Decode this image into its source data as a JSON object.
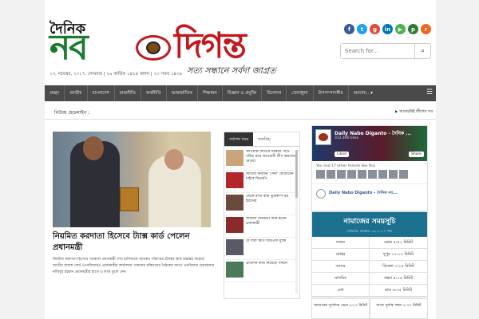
{
  "header": {
    "logo_small": "দৈনিক",
    "logo_nob": "নব",
    "logo_dig": "দিগন্ত",
    "tagline": "সত্য সন্ধানে সর্বদা জাগ্রত",
    "dateline": "১৩, নভেম্বর, ২০১৭, সোমবার | ২৯ কার্তিক ১৪২৪ বঙ্গাব্দ | ২৩ সফর ১৪৩৯",
    "social": [
      {
        "icon": "facebook-icon",
        "glyph": "f",
        "color": "#3b5998"
      },
      {
        "icon": "twitter-icon",
        "glyph": "t",
        "color": "#1da1f2"
      },
      {
        "icon": "google-plus-icon",
        "glyph": "g",
        "color": "#dd4b39"
      },
      {
        "icon": "linkedin-icon",
        "glyph": "in",
        "color": "#0077b5"
      },
      {
        "icon": "youtube-icon",
        "glyph": "▶",
        "color": "#4caf50"
      },
      {
        "icon": "pinterest-icon",
        "glyph": "p",
        "color": "#2e7d32"
      },
      {
        "icon": "rss-icon",
        "glyph": "r",
        "color": "#f26522"
      }
    ],
    "search_placeholder": "Search for..."
  },
  "nav": {
    "items": [
      "প্রচ্ছদ",
      "জাতীয়",
      "বাংলাদেশ",
      "রাজনীতি",
      "অর্থনীতি",
      "আন্তর্জাতিক",
      "শিক্ষাঙ্গন",
      "বিজ্ঞান ও প্রযুক্তি",
      "বিনোদন",
      "খেলাধুলা",
      "উপসম্পাদকীয়",
      "অন্যান্য.. ▾"
    ]
  },
  "ticker": {
    "label": "নিউজ হেডলাইন :",
    "right_text": "আবারউই লীগের সব"
  },
  "lead": {
    "title": "নিয়মিত করদাতা হিসেবে ট্যাক্স কার্ড পেলেন প্রধানমন্ত্রী",
    "body": "নিয়মিত করদাতা হিসেবে গতকাল প্রধানমন্ত্রী শেখ হাসিনাকে আয়কর পরিদপ্তর (ট্যাক্স) কার্ড হস্তান্তর করেছে জাতীয় রাজস্ব বোর্ড (এনবিআর)। প্রধানমন্ত্রীর কার্যালয়ে সোমবার মন্ত্রিসভার বৈঠকের আগে এনবিআর চেয়ারম্যান নজিবুর রহমান প্রধানমন্ত্রীর হাতে এ কার্ড তুলে দেন।"
  },
  "tabs": {
    "items": [
      "সর্বশেষ খবর",
      "জনপ্রিয়"
    ],
    "active_index": 0
  },
  "mid_list": [
    {
      "text": "আওয়ামী লীগের সমন্বয়ে পার্টি-গঠিত করে আওয়ামী লীগ ক্ষমতায় নেওয়া",
      "thumb": "#c9a57a"
    },
    {
      "text": "জাতীয় নির্বাচন 'সেনা' মোতায়েন চাইবে বিএনপি",
      "thumb": "#b3262a"
    },
    {
      "text": "জেনে রাখা বারা ভুমিকম্প হয় ইরানের",
      "thumb": "#6a4a3a"
    },
    {
      "text": "সাধারণ নির্বাচনে যিনি হবেন প্রধানমন্ত্রী",
      "thumb": "#8a2a2a"
    },
    {
      "text": "যে ধারা ঋণে বিডিএফ মুক্তি",
      "thumb": "#5a5a66"
    },
    {
      "text": "প্রতিদিন কার্ড নিয়েছে পাননে",
      "thumb": "#4a7a5a"
    }
  ],
  "facebook": {
    "name": "Daily Nabo Diganto - দৈনিক ...",
    "likes": "312,490 likes",
    "like_label": "Liked",
    "share_label": "Share",
    "friends": "You and 17 other friends like this",
    "post_name": "Daily Nabo Diganto - দৈনিক নব..."
  },
  "prayer": {
    "title": "নামাজের সময়সূচি",
    "date": "সোমবার, নভেম্বর ১৩, ২০১৭ সাল",
    "rows": [
      {
        "name": "ফজর",
        "time": "ভোর ৪:৫০ মিনিট"
      },
      {
        "name": "যোহর",
        "time": "দুপুর ১২:০২ মিনিট"
      },
      {
        "name": "আসর",
        "time": "বিকেল ৩:১৫ মিনিট"
      },
      {
        "name": "মাগরিব",
        "time": "সন্ধ্যা ৫:১৫ মিনিট"
      },
      {
        "name": "এশা",
        "time": "রাত ৬:৩৫ মিনিট"
      }
    ],
    "sunrise": "আজকের সূর্যোদয় ভোর ৬:১০ মিনিট",
    "sunset": "আজ সূর্যাস্ত সন্ধ্যা ৫:৩৭ মিনিট"
  }
}
